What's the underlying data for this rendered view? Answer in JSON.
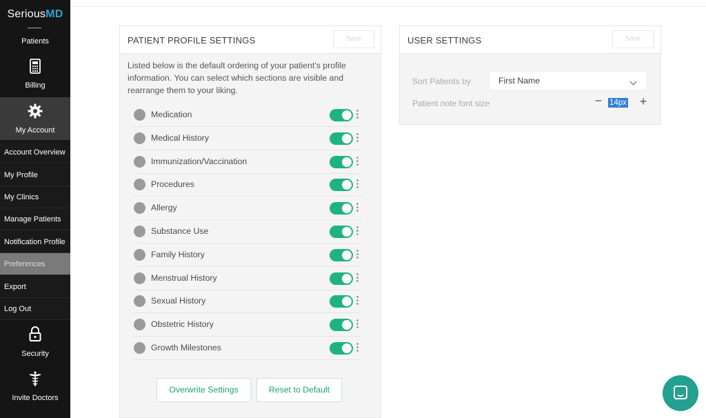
{
  "brand": {
    "prefix": "Serious",
    "suffix": "MD"
  },
  "sidebar": {
    "patients": "Patients",
    "billing": "Billing",
    "my_account": "My Account",
    "submenu": [
      "Account Overview",
      "My Profile",
      "My Clinics",
      "Manage Patients",
      "Notification Profile",
      "Preferences",
      "Export",
      "Log Out"
    ],
    "active": "Preferences",
    "security": "Security",
    "invite": "Invite Doctors"
  },
  "patient_profile": {
    "title": "PATIENT PROFILE SETTINGS",
    "save_label": "Save",
    "description": "Listed below is the default ordering of your patient's profile information. You can select which sections are visible and rearrange them to your liking.",
    "sections": [
      {
        "label": "Medication",
        "icon": "pill-icon",
        "enabled": true
      },
      {
        "label": "Medical History",
        "icon": "medical-kit-icon",
        "enabled": true
      },
      {
        "label": "Immunization/Vaccination",
        "icon": "syringe-icon",
        "enabled": true
      },
      {
        "label": "Procedures",
        "icon": "clipboard-icon",
        "enabled": true
      },
      {
        "label": "Allergy",
        "icon": "allergy-icon",
        "enabled": true
      },
      {
        "label": "Substance Use",
        "icon": "skull-icon",
        "enabled": true
      },
      {
        "label": "Family History",
        "icon": "family-icon",
        "enabled": true
      },
      {
        "label": "Menstrual History",
        "icon": "female-icon",
        "enabled": true
      },
      {
        "label": "Sexual History",
        "icon": "gender-icon",
        "enabled": true
      },
      {
        "label": "Obstetric History",
        "icon": "pregnancy-icon",
        "enabled": true
      },
      {
        "label": "Growth Milestones",
        "icon": "growth-chart-icon",
        "enabled": true
      }
    ],
    "overwrite_label": "Overwrite Settings",
    "reset_label": "Reset to Default"
  },
  "user_settings": {
    "title": "USER SETTINGS",
    "save_label": "Save",
    "sort_label": "Sort Patients by",
    "sort_value": "First Name",
    "font_label": "Patient note font size",
    "font_value": "14px",
    "minus": "−",
    "plus": "+"
  },
  "colors": {
    "toggle_on": "#1fb37f",
    "accent_text": "#1aa270",
    "chat_button": "#23a08f",
    "selection": "#2e7fd6"
  }
}
